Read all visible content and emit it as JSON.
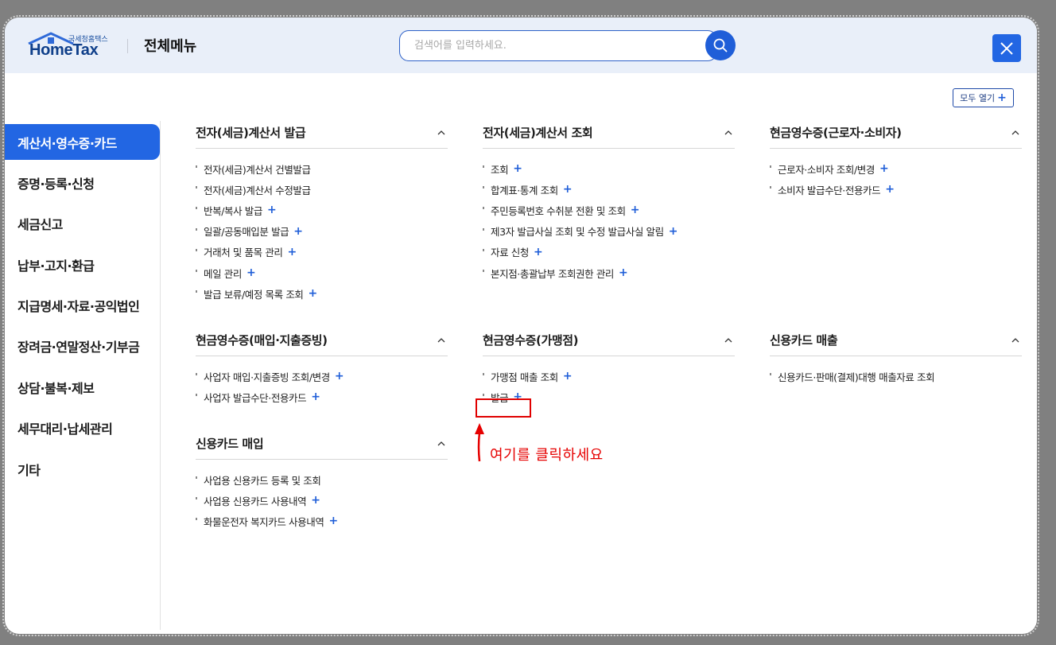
{
  "header": {
    "logo_small": "국세청홈택스",
    "logo_main": "HomeTax",
    "title": "전체메뉴",
    "search_placeholder": "검색어를 입력하세요."
  },
  "expand_all_label": "모두 열기",
  "sidebar": {
    "items": [
      {
        "label": "계산서·영수증·카드",
        "active": true
      },
      {
        "label": "증명·등록·신청"
      },
      {
        "label": "세금신고"
      },
      {
        "label": "납부·고지·환급"
      },
      {
        "label": "지급명세·자료·공익법인"
      },
      {
        "label": "장려금·연말정산·기부금"
      },
      {
        "label": "상담·불복·제보"
      },
      {
        "label": "세무대리·납세관리"
      },
      {
        "label": "기타"
      }
    ]
  },
  "sections": {
    "s1": {
      "title": "전자(세금)계산서 발급",
      "items": [
        "전자(세금)계산서 건별발급",
        "전자(세금)계산서 수정발급",
        "반복/복사 발급",
        "일괄/공동매입분 발급",
        "거래처 및 품목 관리",
        "메일 관리",
        "발급 보류/예정 목록 조회"
      ]
    },
    "s2": {
      "title": "전자(세금)계산서 조회",
      "items": [
        "조회",
        "합계표·통계 조회",
        "주민등록번호 수취분 전환 및 조회",
        "제3자 발급사실 조회 및 수정 발급사실 알림",
        "자료 신청",
        "본지점·총괄납부 조회권한 관리"
      ]
    },
    "s3": {
      "title": "현금영수증(근로자·소비자)",
      "items": [
        "근로자·소비자 조회/변경",
        "소비자 발급수단·전용카드"
      ]
    },
    "s4": {
      "title": "현금영수증(매입·지출증빙)",
      "items": [
        "사업자 매입·지출증빙 조회/변경",
        "사업자 발급수단·전용카드"
      ]
    },
    "s5": {
      "title": "현금영수증(가맹점)",
      "items": [
        "가맹점 매출 조회",
        "발급"
      ]
    },
    "s6": {
      "title": "신용카드 매출",
      "items": [
        "신용카드·판매(결제)대행 매출자료 조회"
      ]
    },
    "s7": {
      "title": "신용카드 매입",
      "items": [
        "사업용 신용카드 등록 및 조회",
        "사업용 신용카드 사용내역",
        "화물운전자 복지카드 사용내역"
      ]
    }
  },
  "annotation": {
    "text": "여기를 클릭하세요",
    "color": "#e60000"
  },
  "colors": {
    "accent": "#2266e3",
    "header_bg": "#e9eff9",
    "overlay": "#808080"
  },
  "icons": [
    "house-roof-logo-icon",
    "search-icon",
    "close-icon",
    "chevron-up-icon",
    "plus-icon",
    "arrow-up-icon"
  ]
}
